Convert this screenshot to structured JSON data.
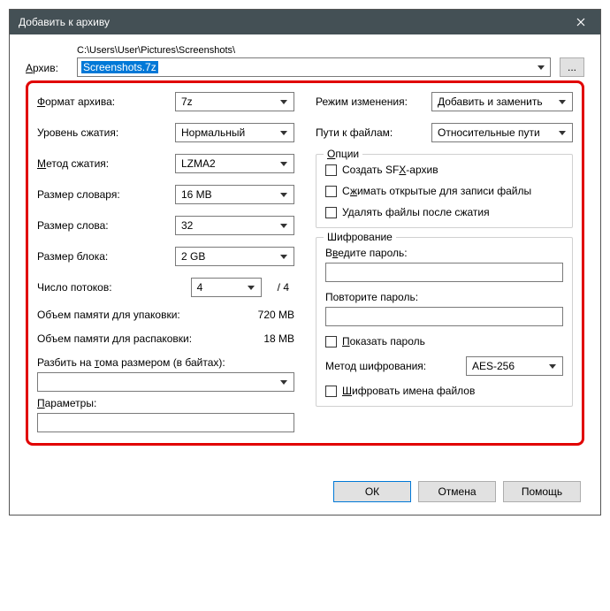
{
  "titlebar": {
    "title": "Добавить к архиву"
  },
  "archive": {
    "label": "Архив:",
    "path": "C:\\Users\\User\\Pictures\\Screenshots\\",
    "filename": "Screenshots.7z",
    "browse": "..."
  },
  "left": {
    "format_label": "Формат архива:",
    "format_value": "7z",
    "level_label": "Уровень сжатия:",
    "level_value": "Нормальный",
    "method_label": "Метод сжатия:",
    "method_value": "LZMA2",
    "dict_label": "Размер словаря:",
    "dict_value": "16 MB",
    "word_label": "Размер слова:",
    "word_value": "32",
    "block_label": "Размер блока:",
    "block_value": "2 GB",
    "threads_label": "Число потоков:",
    "threads_value": "4",
    "threads_max": "/ 4",
    "mem_pack_label": "Объем памяти для упаковки:",
    "mem_pack_value": "720 MB",
    "mem_unpack_label": "Объем памяти для распаковки:",
    "mem_unpack_value": "18 MB",
    "split_label": "Разбить на тома размером (в байтах):",
    "params_label": "Параметры:"
  },
  "right": {
    "mode_label": "Режим изменения:",
    "mode_value": "Добавить и заменить",
    "paths_label": "Пути к файлам:",
    "paths_value": "Относительные пути",
    "options_legend": "Опции",
    "opt_sfx": "Создать SFX-архив",
    "opt_open": "Сжимать открытые для записи файлы",
    "opt_delete": "Удалять файлы после сжатия",
    "enc_legend": "Шифрование",
    "pw1_label": "Введите пароль:",
    "pw2_label": "Повторите пароль:",
    "show_pw": "Показать пароль",
    "enc_method_label": "Метод шифрования:",
    "enc_method_value": "AES-256",
    "enc_names": "Шифровать имена файлов"
  },
  "buttons": {
    "ok": "ОК",
    "cancel": "Отмена",
    "help": "Помощь"
  }
}
